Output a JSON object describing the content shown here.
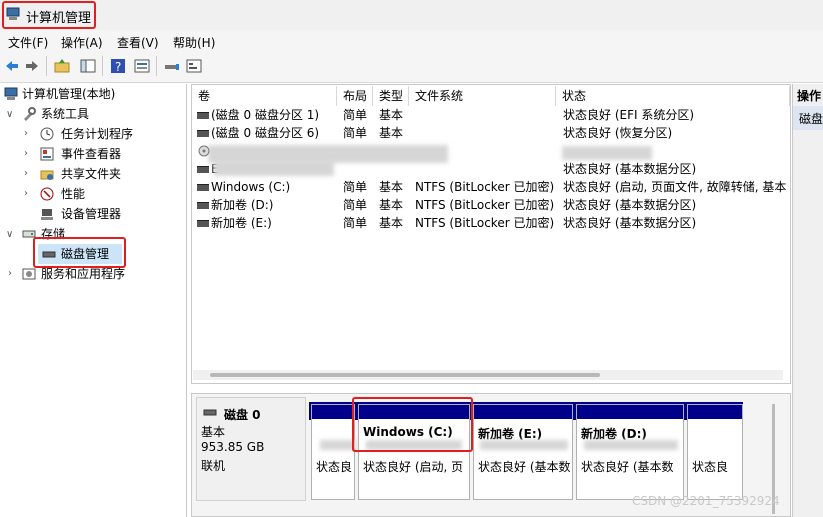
{
  "window": {
    "title": "计算机管理"
  },
  "menu": [
    "文件(F)",
    "操作(A)",
    "查看(V)",
    "帮助(H)"
  ],
  "toolbar_icons": [
    "back-icon",
    "forward-icon",
    "up-folder-icon",
    "show-hide-tree-icon",
    "help-icon",
    "properties-icon",
    "connect-icon",
    "console-icon"
  ],
  "tree": {
    "root": "计算机管理(本地)",
    "system_tools": "系统工具",
    "task_scheduler": "任务计划程序",
    "event_viewer": "事件查看器",
    "shared_folders": "共享文件夹",
    "performance": "性能",
    "device_manager": "设备管理器",
    "storage": "存储",
    "disk_management": "磁盘管理",
    "services_apps": "服务和应用程序"
  },
  "volume_list": {
    "columns": [
      "卷",
      "布局",
      "类型",
      "文件系统",
      "状态"
    ],
    "rows": [
      {
        "volume": "(磁盘 0 磁盘分区 1)",
        "layout": "简单",
        "type": "基本",
        "fs": "",
        "status": "状态良好 (EFI 系统分区)"
      },
      {
        "volume": "(磁盘 0 磁盘分区 6)",
        "layout": "简单",
        "type": "基本",
        "fs": "",
        "status": "状态良好 (恢复分区)"
      },
      {
        "volume": "",
        "layout": "",
        "type": "",
        "fs": "",
        "status": ""
      },
      {
        "volume": "E",
        "layout": "",
        "type": "",
        "fs": "",
        "status": "状态良好 (基本数据分区)"
      },
      {
        "volume": "Windows (C:)",
        "layout": "简单",
        "type": "基本",
        "fs": "NTFS (BitLocker 已加密)",
        "status": "状态良好 (启动, 页面文件, 故障转储, 基本"
      },
      {
        "volume": "新加卷 (D:)",
        "layout": "简单",
        "type": "基本",
        "fs": "NTFS (BitLocker 已加密)",
        "status": "状态良好 (基本数据分区)"
      },
      {
        "volume": "新加卷 (E:)",
        "layout": "简单",
        "type": "基本",
        "fs": "NTFS (BitLocker 已加密)",
        "status": "状态良好 (基本数据分区)"
      }
    ]
  },
  "actions": {
    "header": "操作",
    "item": "磁盘"
  },
  "disk": {
    "name": "磁盘 0",
    "type": "基本",
    "size": "953.85 GB",
    "state": "联机",
    "partitions": [
      {
        "name": "",
        "line2": "",
        "status": "状态良"
      },
      {
        "name": "Windows  (C:)",
        "line2": "",
        "status": "状态良好 (启动, 页"
      },
      {
        "name": "新加卷  (E:)",
        "line2": "",
        "status": "状态良好 (基本数"
      },
      {
        "name": "新加卷  (D:)",
        "line2": "",
        "status": "状态良好 (基本数"
      },
      {
        "name": "",
        "line2": "",
        "status": "状态良"
      }
    ]
  },
  "watermark": "CSDN @2201_75392924",
  "colors": {
    "partition_bar": "#00008b",
    "highlight": "#e02020"
  }
}
